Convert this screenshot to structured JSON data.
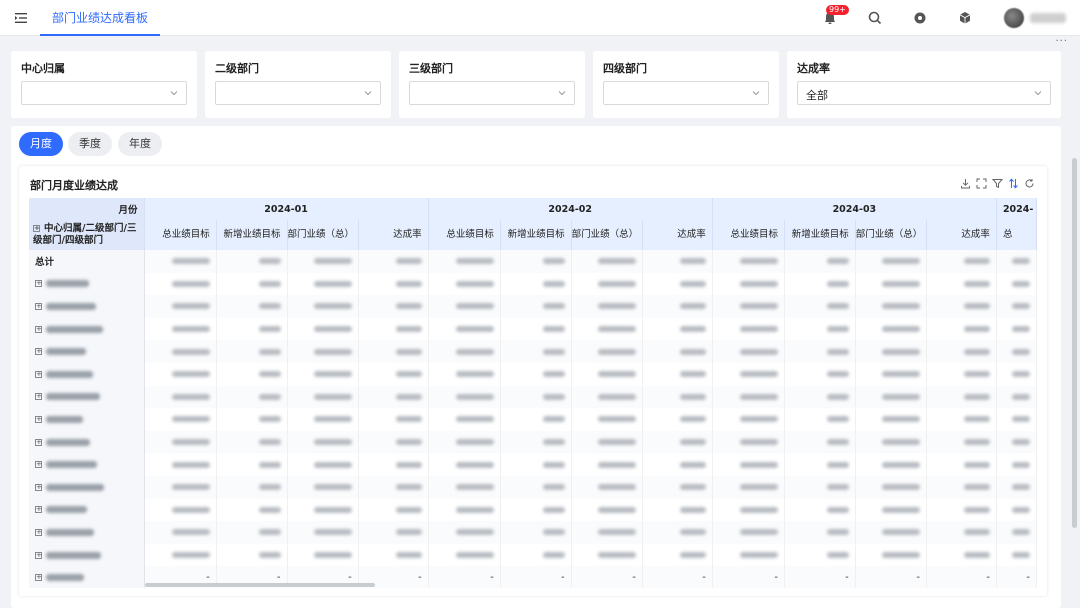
{
  "topbar": {
    "tab_label": "部门业绩达成看板",
    "badge": "99+",
    "icons": [
      "menu-fold-icon",
      "bell-icon",
      "search-icon",
      "settings-icon",
      "cube-icon"
    ]
  },
  "filters": [
    {
      "label": "中心归属",
      "value": ""
    },
    {
      "label": "二级部门",
      "value": ""
    },
    {
      "label": "三级部门",
      "value": ""
    },
    {
      "label": "四级部门",
      "value": ""
    },
    {
      "label": "达成率",
      "value": "全部"
    }
  ],
  "periods": [
    {
      "label": "月度",
      "active": true
    },
    {
      "label": "季度",
      "active": false
    },
    {
      "label": "年度",
      "active": false
    }
  ],
  "report": {
    "title": "部门月度业绩达成",
    "tool_icons": [
      "download-icon",
      "fullscreen-icon",
      "filter-icon",
      "sort-icon",
      "refresh-icon"
    ],
    "month_label": "月份",
    "dim_label": "中心归属/二级部门/三级部门/四级部门",
    "months": [
      "2024-01",
      "2024-02",
      "2024-03",
      "2024-"
    ],
    "sub_columns": [
      "总业绩目标",
      "新增业绩目标",
      "部门业绩（总）",
      "达成率"
    ],
    "last_partial_column": "总",
    "total_label": "总计",
    "row_count": 15,
    "last_row_values": "-"
  },
  "colors": {
    "accent": "#2f6bff",
    "header_bg": "#e6efff",
    "badge": "#f5222d"
  }
}
